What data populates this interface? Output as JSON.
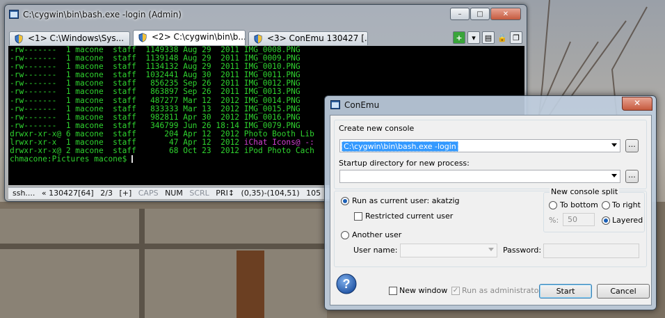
{
  "main_window": {
    "title": "C:\\cygwin\\bin\\bash.exe -login (Admin)",
    "tabs": [
      {
        "label": "<1>  C:\\Windows\\Sys..."
      },
      {
        "label": "<2> C:\\cygwin\\bin\\b..."
      },
      {
        "label": "<3> ConEmu 130427 [..."
      }
    ],
    "console_lines": [
      "-rw-------  1 macone  staff  1149338 Aug 29  2011 IMG_0008.PNG",
      "-rw-------  1 macone  staff  1139148 Aug 29  2011 IMG_0009.PNG",
      "-rw-------  1 macone  staff  1134132 Aug 29  2011 IMG_0010.PNG",
      "-rw-------  1 macone  staff  1032441 Aug 30  2011 IMG_0011.PNG",
      "-rw-------  1 macone  staff   856235 Sep 26  2011 IMG_0012.PNG",
      "-rw-------  1 macone  staff   863897 Sep 26  2011 IMG_0013.PNG",
      "-rw-------  1 macone  staff   487277 Mar 12  2012 IMG_0014.PNG",
      "-rw-------  1 macone  staff   833333 Mar 13  2012 IMG_0015.PNG",
      "-rw-------  1 macone  staff   982811 Apr 30  2012 IMG_0016.PNG",
      "-rw-------  1 macone  staff   346799 Jun 26 18:14 IMG_0079.PNG",
      "drwxr-xr-x@ 6 macone  staff      204 Apr 12  2012 Photo Booth Lib",
      "lrwxr-xr-x  1 macone  staff       47 Apr 12  2012 ",
      "drwxr-xr-x@ 2 macone  staff       68 Oct 23  2012 iPod Photo Cach"
    ],
    "console_link": "iChat Icons@ -:",
    "prompt": "chmacone:Pictures macone$ ",
    "status": {
      "proc": "ssh....",
      "ver": "« 130427[64]",
      "tab_pos": "2/3",
      "plus": "[+]",
      "caps": "CAPS",
      "num": "NUM",
      "scrl": "SCRL",
      "pri": "PRI↕",
      "coords": "(0,35)-(104,51)",
      "extra": "105"
    }
  },
  "dialog": {
    "title": "ConEmu",
    "close_label": "✕",
    "create_label": "Create new console",
    "command_value": "C:\\cygwin\\bin\\bash.exe -login",
    "dots_label": "...",
    "startup_label": "Startup directory for new process:",
    "startup_value": "",
    "run_current_label": "Run as current user: akatzig",
    "restricted_label": "Restricted current user",
    "another_user_label": "Another user",
    "user_name_label": "User name:",
    "password_label": "Password:",
    "split_label": "New console split",
    "to_bottom_label": "To bottom",
    "to_right_label": "To right",
    "percent_label": "%:",
    "percent_value": "50",
    "layered_label": "Layered",
    "new_window_label": "New window",
    "run_admin_label": "Run as administrator",
    "start_label": "Start",
    "cancel_label": "Cancel"
  },
  "colors": {
    "console_text": "#2fd42f",
    "console_link": "#d040d0",
    "selection": "#3399ff"
  }
}
